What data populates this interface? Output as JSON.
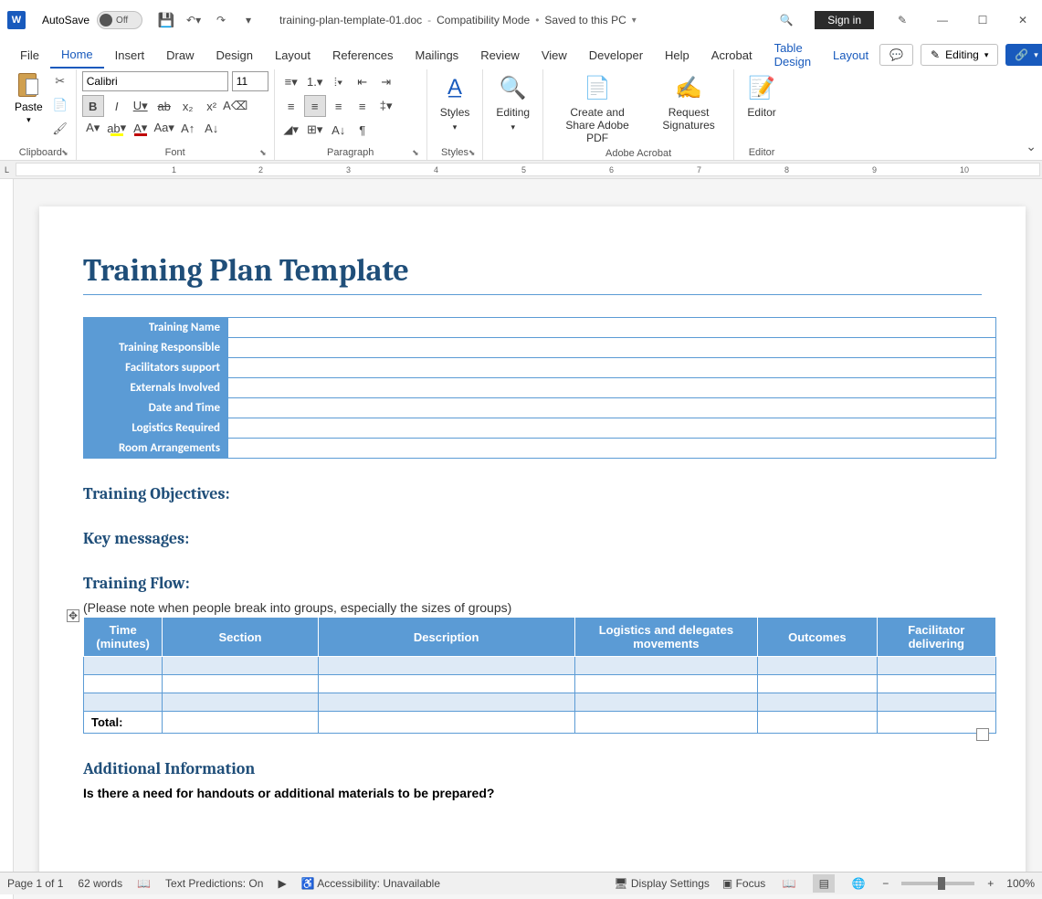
{
  "titlebar": {
    "autosave": "AutoSave",
    "autosave_state": "Off",
    "filename": "training-plan-template-01.doc",
    "mode": "Compatibility Mode",
    "saved": "Saved to this PC",
    "signin": "Sign in"
  },
  "tabs": {
    "file": "File",
    "home": "Home",
    "insert": "Insert",
    "draw": "Draw",
    "design": "Design",
    "layout": "Layout",
    "references": "References",
    "mailings": "Mailings",
    "review": "Review",
    "view": "View",
    "developer": "Developer",
    "help": "Help",
    "acrobat": "Acrobat",
    "table_design": "Table Design",
    "layout2": "Layout",
    "editing_mode": "Editing"
  },
  "ribbon": {
    "paste": "Paste",
    "clipboard": "Clipboard",
    "font_name": "Calibri",
    "font_size": "11",
    "font": "Font",
    "paragraph": "Paragraph",
    "styles": "Styles",
    "editing": "Editing",
    "create_share": "Create and Share Adobe PDF",
    "request_sig": "Request Signatures",
    "adobe": "Adobe Acrobat",
    "editor": "Editor",
    "editor_group": "Editor"
  },
  "document": {
    "title": "Training Plan Template",
    "info_rows": [
      "Training Name",
      "Training Responsible",
      "Facilitators support",
      "Externals Involved",
      "Date and Time",
      "Logistics Required",
      "Room Arrangements"
    ],
    "objectives": "Training Objectives:",
    "key_messages": "Key messages:",
    "training_flow": "Training Flow:",
    "flow_note": "(Please note when people break into groups, especially the sizes of groups)",
    "flow_headers": [
      "Time (minutes)",
      "Section",
      "Description",
      "Logistics and delegates movements",
      "Outcomes",
      "Facilitator delivering"
    ],
    "total": "Total:",
    "additional": "Additional Information",
    "addl_q": "Is there a need for handouts or additional materials to be prepared?"
  },
  "status": {
    "page": "Page 1 of 1",
    "words": "62 words",
    "predictions": "Text Predictions: On",
    "accessibility": "Accessibility: Unavailable",
    "display": "Display Settings",
    "focus": "Focus",
    "zoom": "100%"
  }
}
